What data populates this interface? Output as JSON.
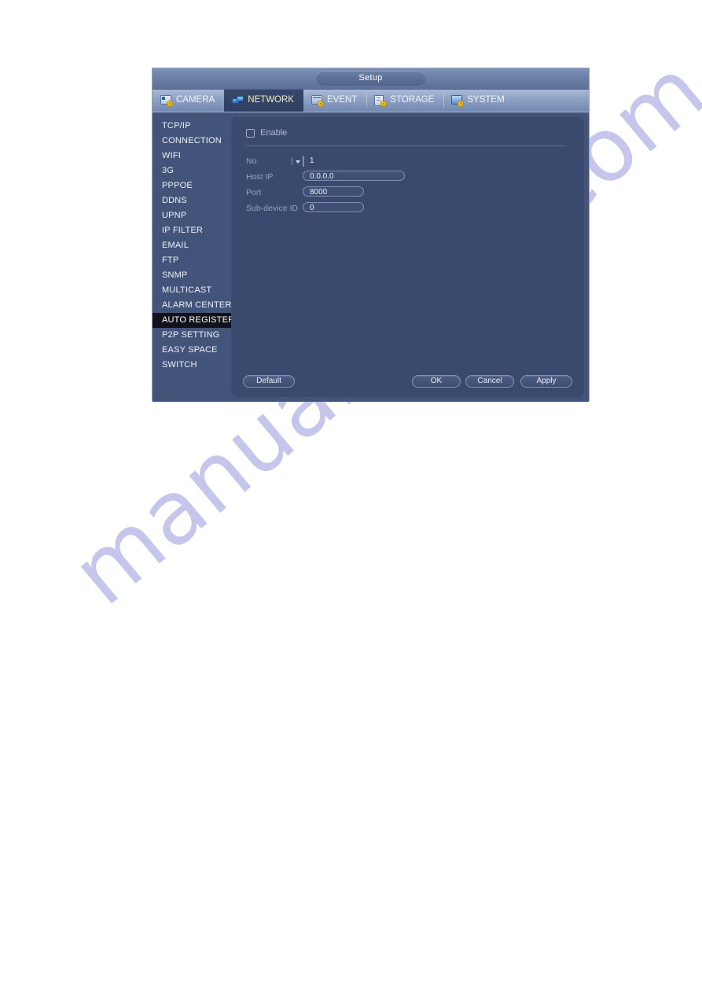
{
  "page": {
    "watermark": "manualshive.com"
  },
  "window": {
    "title": "Setup"
  },
  "tabs": [
    {
      "label": "CAMERA",
      "icon": "camera-gear-icon",
      "active": false
    },
    {
      "label": "NETWORK",
      "icon": "network-cube-icon",
      "active": true
    },
    {
      "label": "EVENT",
      "icon": "event-gear-icon",
      "active": false
    },
    {
      "label": "STORAGE",
      "icon": "storage-gear-icon",
      "active": false
    },
    {
      "label": "SYSTEM",
      "icon": "system-gear-icon",
      "active": false
    }
  ],
  "sidebar": {
    "selected": "AUTO REGISTER",
    "items": [
      {
        "label": "TCP/IP"
      },
      {
        "label": "CONNECTION"
      },
      {
        "label": "WIFI"
      },
      {
        "label": "3G"
      },
      {
        "label": "PPPOE"
      },
      {
        "label": "DDNS"
      },
      {
        "label": "UPNP"
      },
      {
        "label": "IP FILTER"
      },
      {
        "label": "EMAIL"
      },
      {
        "label": "FTP"
      },
      {
        "label": "SNMP"
      },
      {
        "label": "MULTICAST"
      },
      {
        "label": "ALARM CENTER"
      },
      {
        "label": "AUTO REGISTER"
      },
      {
        "label": "P2P SETTING"
      },
      {
        "label": "EASY SPACE"
      },
      {
        "label": "SWITCH"
      }
    ]
  },
  "form": {
    "enable": {
      "label": "Enable",
      "checked": false
    },
    "fields": {
      "no": {
        "label": "No.",
        "value": "1"
      },
      "host_ip": {
        "label": "Host IP",
        "value": "0.0.0.0"
      },
      "port": {
        "label": "Port",
        "value": "8000"
      },
      "sub_device": {
        "label": "Sub-device ID",
        "value": "0"
      }
    }
  },
  "footer": {
    "default_label": "Default",
    "ok_label": "OK",
    "cancel_label": "Cancel",
    "apply_label": "Apply"
  },
  "colors": {
    "window_bg": "#3e4f73",
    "panel_bg": "#3a4a6e",
    "sidebar_bg": "#42547a",
    "tab_active_bg": "#36476b",
    "tab_active_text": "#f4efc8",
    "selected_item_bg": "#10121c",
    "label_text": "#93a4c4",
    "watermark": "#c3c2ea"
  }
}
